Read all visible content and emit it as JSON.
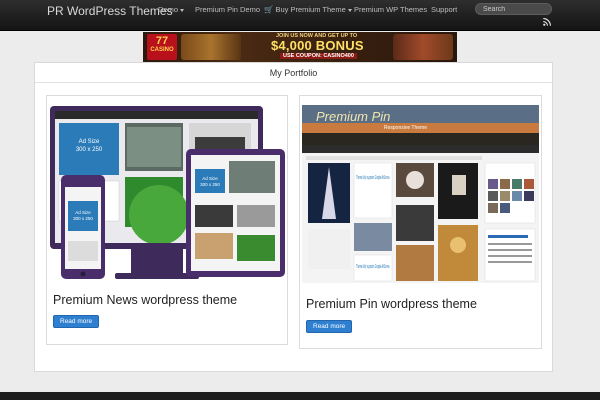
{
  "navbar": {
    "brand": "PR WordPress Themes",
    "links": [
      {
        "label": "Demo",
        "dropdown": true
      },
      {
        "label": "Premium Pin Demo",
        "dropdown": false
      },
      {
        "label": "Buy Premium Theme",
        "dropdown": true
      },
      {
        "label": "Premium WP Themes",
        "dropdown": false
      },
      {
        "label": "Support",
        "dropdown": false
      }
    ],
    "search_placeholder": "Search"
  },
  "banner": {
    "logo_top": "77",
    "logo_bottom": "CASINO",
    "join_text": "JOIN US NOW AND GET UP TO",
    "bonus_text": "$4,000 BONUS",
    "coupon_text": "USE COUPON: CASINO400"
  },
  "portfolio": {
    "title": "My Portfolio",
    "items": [
      {
        "title": "Premium News wordpress theme",
        "button": "Read more"
      },
      {
        "title": "Premium Pin wordpress theme",
        "button": "Read more"
      }
    ]
  },
  "news_mock": {
    "ad_label": "Ad Size",
    "ad_size": "300 x 250",
    "ad_size_small": "300 x 250",
    "ad_label_phone": "Ad Size",
    "ad_size_phone": "300 x 250"
  },
  "pin_mock": {
    "site_title": "Premium Pin",
    "tagline": "Responsive Theme",
    "quote": "Theme fully supports Google AdSense.",
    "quote2": "Theme fully supports Google AdSense."
  },
  "colors": {
    "navbar": "#1e1e1e",
    "button": "#2f7fd0",
    "purple_frame": "#4a2e6b"
  }
}
